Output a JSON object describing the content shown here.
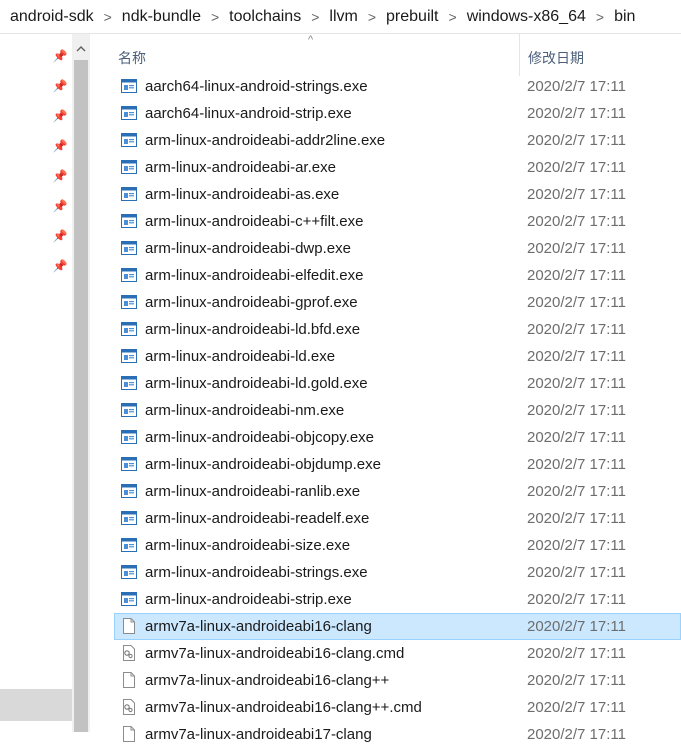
{
  "breadcrumb": [
    "android-sdk",
    "ndk-bundle",
    "toolchains",
    "llvm",
    "prebuilt",
    "windows-x86_64",
    "bin"
  ],
  "breadcrumb_separator": ">",
  "columns": {
    "name": "名称",
    "date_modified": "修改日期"
  },
  "sort_indicator": "^",
  "colors": {
    "selection_fill": "#cce8ff",
    "selection_border": "#99d1ff",
    "header_text": "#4c607a"
  },
  "files": [
    {
      "name": "aarch64-linux-android-strings.exe",
      "date": "2020/2/7 17:11",
      "icon": "exe-icon"
    },
    {
      "name": "aarch64-linux-android-strip.exe",
      "date": "2020/2/7 17:11",
      "icon": "exe-icon"
    },
    {
      "name": "arm-linux-androideabi-addr2line.exe",
      "date": "2020/2/7 17:11",
      "icon": "exe-icon"
    },
    {
      "name": "arm-linux-androideabi-ar.exe",
      "date": "2020/2/7 17:11",
      "icon": "exe-icon"
    },
    {
      "name": "arm-linux-androideabi-as.exe",
      "date": "2020/2/7 17:11",
      "icon": "exe-icon"
    },
    {
      "name": "arm-linux-androideabi-c++filt.exe",
      "date": "2020/2/7 17:11",
      "icon": "exe-icon"
    },
    {
      "name": "arm-linux-androideabi-dwp.exe",
      "date": "2020/2/7 17:11",
      "icon": "exe-icon"
    },
    {
      "name": "arm-linux-androideabi-elfedit.exe",
      "date": "2020/2/7 17:11",
      "icon": "exe-icon"
    },
    {
      "name": "arm-linux-androideabi-gprof.exe",
      "date": "2020/2/7 17:11",
      "icon": "exe-icon"
    },
    {
      "name": "arm-linux-androideabi-ld.bfd.exe",
      "date": "2020/2/7 17:11",
      "icon": "exe-icon"
    },
    {
      "name": "arm-linux-androideabi-ld.exe",
      "date": "2020/2/7 17:11",
      "icon": "exe-icon"
    },
    {
      "name": "arm-linux-androideabi-ld.gold.exe",
      "date": "2020/2/7 17:11",
      "icon": "exe-icon"
    },
    {
      "name": "arm-linux-androideabi-nm.exe",
      "date": "2020/2/7 17:11",
      "icon": "exe-icon"
    },
    {
      "name": "arm-linux-androideabi-objcopy.exe",
      "date": "2020/2/7 17:11",
      "icon": "exe-icon"
    },
    {
      "name": "arm-linux-androideabi-objdump.exe",
      "date": "2020/2/7 17:11",
      "icon": "exe-icon"
    },
    {
      "name": "arm-linux-androideabi-ranlib.exe",
      "date": "2020/2/7 17:11",
      "icon": "exe-icon"
    },
    {
      "name": "arm-linux-androideabi-readelf.exe",
      "date": "2020/2/7 17:11",
      "icon": "exe-icon"
    },
    {
      "name": "arm-linux-androideabi-size.exe",
      "date": "2020/2/7 17:11",
      "icon": "exe-icon"
    },
    {
      "name": "arm-linux-androideabi-strings.exe",
      "date": "2020/2/7 17:11",
      "icon": "exe-icon"
    },
    {
      "name": "arm-linux-androideabi-strip.exe",
      "date": "2020/2/7 17:11",
      "icon": "exe-icon"
    },
    {
      "name": "armv7a-linux-androideabi16-clang",
      "date": "2020/2/7 17:11",
      "icon": "file-icon",
      "selected": true
    },
    {
      "name": "armv7a-linux-androideabi16-clang.cmd",
      "date": "2020/2/7 17:11",
      "icon": "cmd-file-icon"
    },
    {
      "name": "armv7a-linux-androideabi16-clang++",
      "date": "2020/2/7 17:11",
      "icon": "file-icon"
    },
    {
      "name": "armv7a-linux-androideabi16-clang++.cmd",
      "date": "2020/2/7 17:11",
      "icon": "cmd-file-icon"
    },
    {
      "name": "armv7a-linux-androideabi17-clang",
      "date": "2020/2/7 17:11",
      "icon": "file-icon"
    }
  ]
}
